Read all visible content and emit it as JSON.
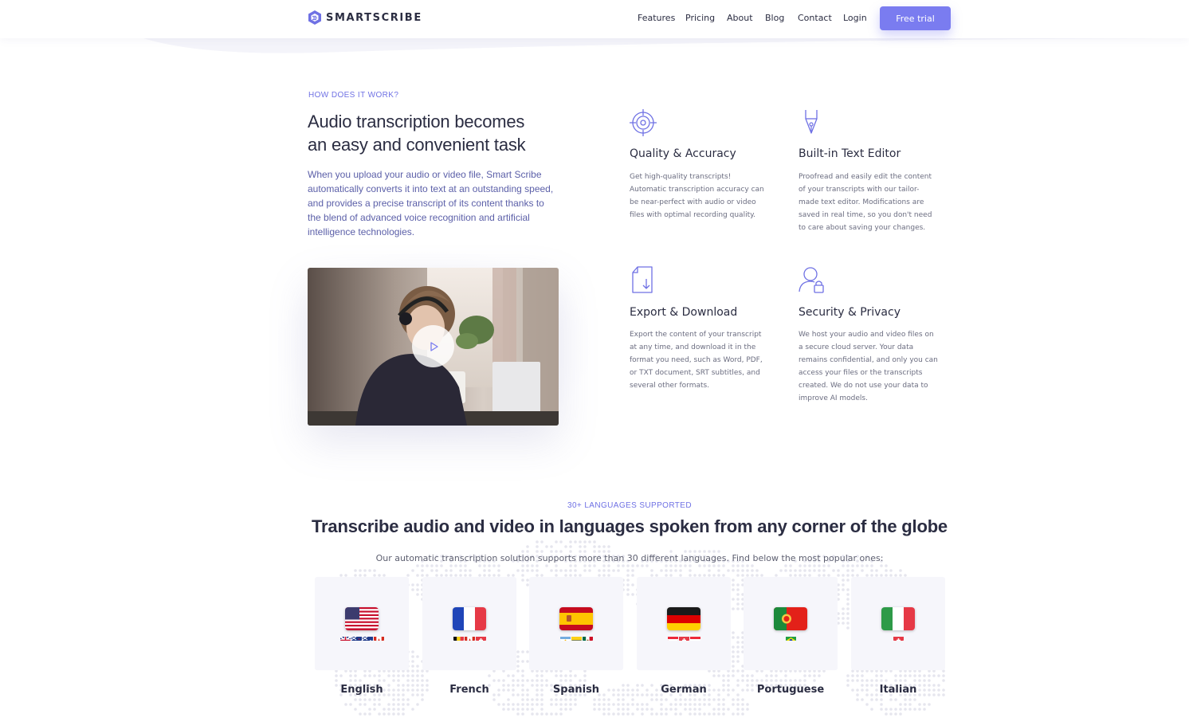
{
  "nav": {
    "brand": "SMARTSCRIBE",
    "links": [
      "Features",
      "Pricing",
      "About",
      "Blog",
      "Contact",
      "Login"
    ],
    "cta": "Free trial"
  },
  "how": {
    "eyebrow": "HOW DOES IT WORK?",
    "title_line1": "Audio transcription becomes",
    "title_line2": "an easy and convenient task",
    "body": "When you upload your audio or video file, Smart Scribe automatically converts it into text at an outstanding speed, and provides a precise transcript of its content thanks to the blend of advanced voice recognition and artificial intelligence technologies.",
    "video_icon": "play-icon"
  },
  "features": [
    {
      "title": "Quality & Accuracy",
      "icon": "target-icon",
      "body": "Get high-quality transcripts! Automatic transcription accuracy can be near-perfect with audio or video files with optimal recording quality."
    },
    {
      "title": "Built-in Text Editor",
      "icon": "pen-nib-icon",
      "body": "Proofread and easily edit the content of your transcripts with our tailor-made text editor. Modifications are saved in real time, so you don't need to care about saving your changes."
    },
    {
      "title": "Export & Download",
      "icon": "document-download-icon",
      "body": "Export the content of your transcript at any time, and download it in the format you need, such as Word, PDF, or TXT document, SRT subtitles, and several other formats."
    },
    {
      "title": "Security & Privacy",
      "icon": "user-lock-icon",
      "body": "We host your audio and video files on a secure cloud server. Your data remains confidential, and only you can access your files or the transcripts created. We do not use your data to improve AI models."
    }
  ],
  "languages": {
    "eyebrow": "30+ LANGUAGES SUPPORTED",
    "title": "Transcribe audio and video in languages spoken from any corner of the globe",
    "subtitle": "Our automatic transcription solution supports more than 30 different languages. Find below the most popular ones:",
    "items": [
      {
        "name": "English",
        "flag": "us-flag-icon"
      },
      {
        "name": "French",
        "flag": "fr-flag-icon"
      },
      {
        "name": "Spanish",
        "flag": "es-flag-icon"
      },
      {
        "name": "German",
        "flag": "de-flag-icon"
      },
      {
        "name": "Portuguese",
        "flag": "pt-flag-icon"
      },
      {
        "name": "Italian",
        "flag": "it-flag-icon"
      }
    ]
  },
  "colors": {
    "accent": "#7a7cf0",
    "eyebrow": "#6f71e4",
    "text": "#2b2d42",
    "card": "#f6f6fb"
  }
}
